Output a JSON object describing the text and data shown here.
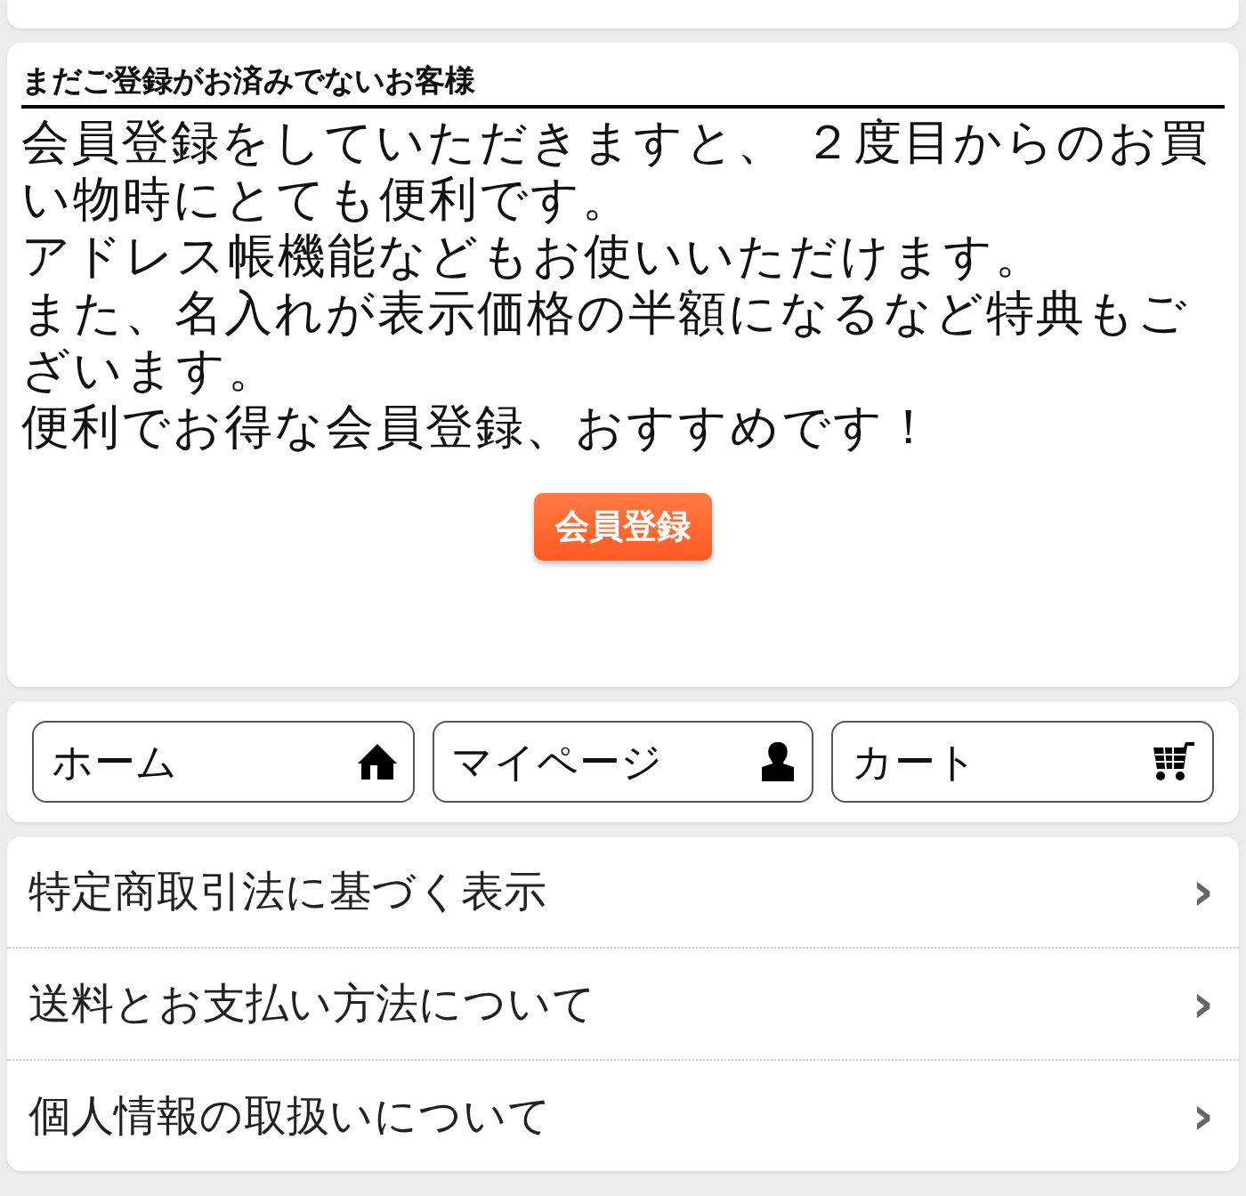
{
  "register_panel": {
    "heading": "まだご登録がお済みでないお客様",
    "paragraphs": [
      "会員登録をしていただきますと、 ２度目からのお買い物時にとても便利です。",
      "アドレス帳機能などもお使いいただけます。",
      "また、名入れが表示価格の半額になるなど特典もございます。",
      "便利でお得な会員登録、おすすめです！"
    ],
    "button": "会員登録"
  },
  "nav_buttons": [
    {
      "label": "ホーム",
      "kind": "home"
    },
    {
      "label": "マイページ",
      "kind": "person"
    },
    {
      "label": "カート",
      "kind": "cart"
    }
  ],
  "links": [
    {
      "label": "特定商取引法に基づく表示",
      "arrow": "›"
    },
    {
      "label": "送料とお支払い方法について",
      "arrow": "›"
    },
    {
      "label": "個人情報の取扱いについて",
      "arrow": "›"
    }
  ]
}
